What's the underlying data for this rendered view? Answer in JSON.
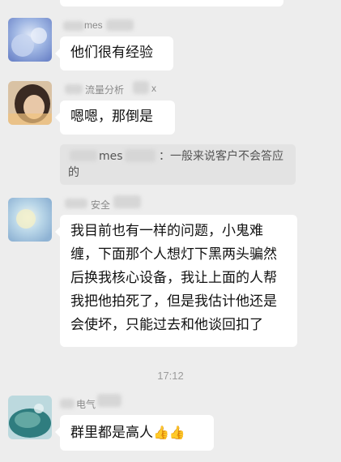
{
  "messages": [
    {
      "name": "mes",
      "text": "他们很有经验"
    },
    {
      "name": "流量分析",
      "name_tail": "x",
      "text": "嗯嗯，那倒是"
    },
    {
      "name": "安全",
      "text": "我目前也有一样的问题，小鬼难缠，下面那个人想灯下黑两头骗然后换我核心设备，我让上面的人帮我把他拍死了，但是我估计他还是会使坏，只能过去和他谈回扣了"
    },
    {
      "name": "电气",
      "text": "群里都是高人",
      "emoji": [
        "👍",
        "👍"
      ]
    }
  ],
  "quote": {
    "name": "mes",
    "text": "：一般来说客户不会答应的"
  },
  "timestamp": "17:12",
  "colors": {
    "background": "#ededed",
    "bubble": "#ffffff",
    "quote_bg": "#e3e3e3",
    "meta_text": "#8a8a8a"
  }
}
